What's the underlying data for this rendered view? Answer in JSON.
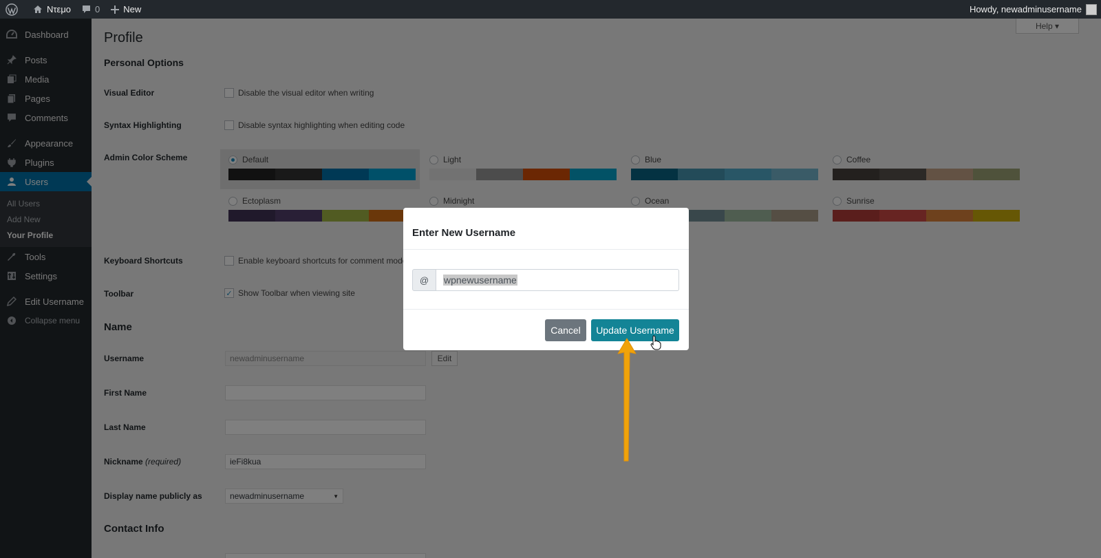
{
  "adminbar": {
    "site_name": "Ντεμο",
    "comments_count": "0",
    "new_label": "New",
    "howdy": "Howdy, newadminusername"
  },
  "sidebar": {
    "items": [
      {
        "label": "Dashboard",
        "icon": "dashboard-icon"
      },
      {
        "label": "Posts",
        "icon": "pin-icon"
      },
      {
        "label": "Media",
        "icon": "media-icon"
      },
      {
        "label": "Pages",
        "icon": "pages-icon"
      },
      {
        "label": "Comments",
        "icon": "comment-icon"
      },
      {
        "label": "Appearance",
        "icon": "brush-icon"
      },
      {
        "label": "Plugins",
        "icon": "plugin-icon"
      },
      {
        "label": "Users",
        "icon": "user-icon"
      },
      {
        "label": "Tools",
        "icon": "wrench-icon"
      },
      {
        "label": "Settings",
        "icon": "settings-icon"
      },
      {
        "label": "Edit Username",
        "icon": "pencil-icon"
      },
      {
        "label": "Collapse menu",
        "icon": "collapse-icon"
      }
    ],
    "users_submenu": [
      "All Users",
      "Add New",
      "Your Profile"
    ]
  },
  "page": {
    "title": "Profile",
    "help": "Help",
    "personal_options": "Personal Options",
    "visual_editor_label": "Visual Editor",
    "visual_editor_text": "Disable the visual editor when writing",
    "syntax_label": "Syntax Highlighting",
    "syntax_text": "Disable syntax highlighting when editing code",
    "color_scheme_label": "Admin Color Scheme",
    "schemes": [
      {
        "name": "Default",
        "colors": [
          "#222",
          "#333",
          "#0073aa",
          "#00a0d2"
        ],
        "selected": true
      },
      {
        "name": "Light",
        "colors": [
          "#e5e5e5",
          "#999",
          "#d64e07",
          "#04a4cc"
        ],
        "selected": false
      },
      {
        "name": "Blue",
        "colors": [
          "#096484",
          "#4796b3",
          "#52accc",
          "#74b6ce"
        ],
        "selected": false
      },
      {
        "name": "Coffee",
        "colors": [
          "#46403c",
          "#59524c",
          "#c7a589",
          "#9ea476"
        ],
        "selected": false
      },
      {
        "name": "Ectoplasm",
        "colors": [
          "#413256",
          "#523f6d",
          "#a3b745",
          "#d46f15"
        ],
        "selected": false
      },
      {
        "name": "Midnight",
        "colors": [
          "#25282b",
          "#363b3f",
          "#69a8bb",
          "#e14d43"
        ],
        "selected": false
      },
      {
        "name": "Ocean",
        "colors": [
          "#627c83",
          "#738e96",
          "#9ebaa0",
          "#aa9d88"
        ],
        "selected": false
      },
      {
        "name": "Sunrise",
        "colors": [
          "#b43c38",
          "#cf4944",
          "#dd823b",
          "#ccaf0b"
        ],
        "selected": false
      }
    ],
    "keyboard_label": "Keyboard Shortcuts",
    "keyboard_text": "Enable keyboard shortcuts for comment mode",
    "toolbar_label": "Toolbar",
    "toolbar_text": "Show Toolbar when viewing site",
    "toolbar_check": "✓",
    "name_heading": "Name",
    "username_label": "Username",
    "username_value": "newadminusername",
    "edit_btn": "Edit",
    "first_name_label": "First Name",
    "last_name_label": "Last Name",
    "nickname_label": "Nickname",
    "nickname_required": "(required)",
    "nickname_value": "ieFi8kua",
    "display_name_label": "Display name publicly as",
    "display_name_value": "newadminusername",
    "contact_heading": "Contact Info"
  },
  "modal": {
    "title": "Enter New Username",
    "prefix": "@",
    "input_value": "wpnewusername",
    "cancel": "Cancel",
    "update": "Update Username"
  },
  "colors": {
    "accent": "#0073aa",
    "update_button": "#17a2b8",
    "cancel_button": "#6c757d",
    "arrow": "#f0a30a"
  }
}
